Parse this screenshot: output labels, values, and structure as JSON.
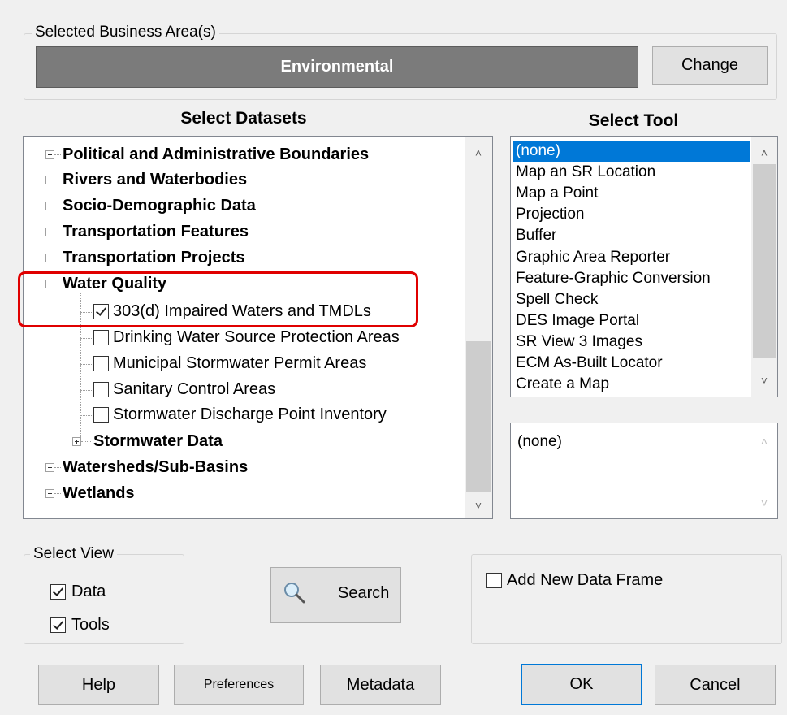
{
  "business_area": {
    "legend": "Selected Business Area(s)",
    "value": "Environmental",
    "change_label": "Change"
  },
  "datasets": {
    "heading": "Select Datasets",
    "nodes": [
      {
        "label": "Political and Administrative Boundaries",
        "expanded": false
      },
      {
        "label": "Rivers and Waterbodies",
        "expanded": false
      },
      {
        "label": "Socio-Demographic Data",
        "expanded": false
      },
      {
        "label": "Transportation Features",
        "expanded": false
      },
      {
        "label": "Transportation Projects",
        "expanded": false
      },
      {
        "label": "Water Quality",
        "expanded": true
      },
      {
        "label": "303(d) Impaired Waters and TMDLs",
        "checked": true
      },
      {
        "label": "Drinking Water Source Protection Areas",
        "checked": false
      },
      {
        "label": "Municipal Stormwater Permit Areas",
        "checked": false
      },
      {
        "label": "Sanitary Control Areas",
        "checked": false
      },
      {
        "label": "Stormwater Discharge Point Inventory",
        "checked": false
      },
      {
        "label": "Stormwater Data",
        "expanded": false
      },
      {
        "label": "Watersheds/Sub-Basins",
        "expanded": false
      },
      {
        "label": "Wetlands",
        "expanded": false
      }
    ]
  },
  "tools": {
    "heading": "Select Tool",
    "items": [
      "(none)",
      "Map an SR Location",
      "Map a Point",
      "Projection",
      "Buffer",
      "Graphic Area Reporter",
      "Feature-Graphic Conversion",
      "Spell Check",
      "DES Image Portal",
      "SR View 3 Images",
      "ECM As-Built Locator",
      "Create a Map"
    ],
    "selected": "(none)",
    "description": "(none)"
  },
  "select_view": {
    "legend": "Select View",
    "data_label": "Data",
    "data_checked": true,
    "tools_label": "Tools",
    "tools_checked": true
  },
  "search_label": "Search",
  "add_frame": {
    "label": "Add New Data Frame",
    "checked": false
  },
  "footer": {
    "help": "Help",
    "preferences": "Preferences",
    "metadata": "Metadata",
    "ok": "OK",
    "cancel": "Cancel"
  },
  "colors": {
    "highlight": "#e00000",
    "selection": "#0078d7"
  },
  "icons": {
    "search": "magnifier-icon",
    "tree_expand": "plus-icon",
    "tree_collapse": "minus-icon",
    "scroll_up": "chevron-up-icon",
    "scroll_down": "chevron-down-icon"
  }
}
